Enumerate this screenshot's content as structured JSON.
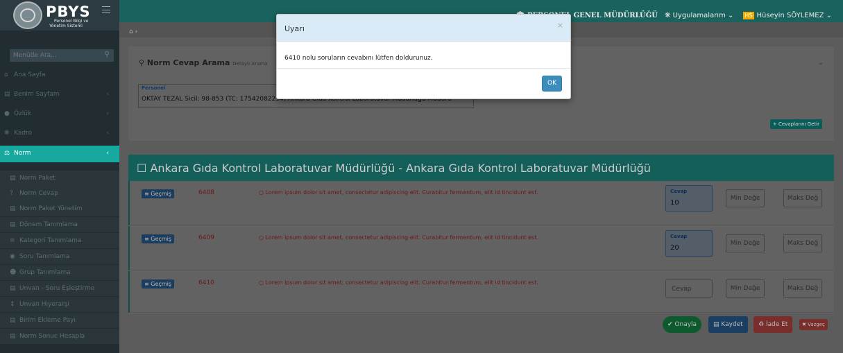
{
  "app": {
    "title": "PBYS",
    "subtitle_line1": "Personel Bilgi ve",
    "subtitle_line2": "Yönetim Sistemi"
  },
  "sidebar": {
    "search_placeholder": "Menüde Ara...",
    "items": [
      {
        "label": "Ana Sayfa",
        "icon": "home-icon"
      },
      {
        "label": "Benim Sayfam",
        "icon": "calendar-icon"
      },
      {
        "label": "Özlük",
        "icon": "user-icon"
      },
      {
        "label": "Kadro",
        "icon": "sitemap-icon"
      },
      {
        "label": "Norm",
        "icon": "balance-icon"
      }
    ],
    "subitems": [
      {
        "label": "Norm Paket",
        "icon": "calendar-icon"
      },
      {
        "label": "Norm Cevap",
        "icon": "question-icon"
      },
      {
        "label": "Norm Paket Yönetim",
        "icon": "calendar-icon"
      },
      {
        "label": "Dönem Tanımlama",
        "icon": "calendar-icon"
      },
      {
        "label": "Kategori Tanımlama",
        "icon": "list-icon"
      },
      {
        "label": "Soru Tanımlama",
        "icon": "question-circle-icon"
      },
      {
        "label": "Grup Tanımlama",
        "icon": "users-icon"
      },
      {
        "label": "Unvan - Soru Eşleştirme",
        "icon": "calendar-icon"
      },
      {
        "label": "Unvan Hiyerarşi",
        "icon": "hierarchy-icon"
      },
      {
        "label": "Birim Ekleme Payı",
        "icon": "calendar-icon"
      },
      {
        "label": "Norm Sonuc Hesapla",
        "icon": "calendar-icon"
      }
    ]
  },
  "topbar": {
    "org": "PERSONEL GENEL MÜDÜRLÜĞÜ",
    "apps": "Uygulamalarım",
    "user_initials": "HS",
    "user_name": "Hüseyin SÖYLEMEZ"
  },
  "search_panel": {
    "title": "Norm Cevap Arama",
    "subtitle": "Detaylı Arama",
    "person_label": "Personel",
    "person_value": "OKTAY TEZAL Sicil: 98-853 (TC: 17542082234) Ankara Gıda Kontrol Laboratuvar Müdürlüğü Müdürü",
    "fetch_button": "Cevaplarını Getir"
  },
  "results": {
    "title": "Ankara Gıda Kontrol Laboratuvar Müdürlüğü - Ankara Gıda Kontrol Laboratuvar Müdürlüğü",
    "history_label": "Geçmiş",
    "answer_label": "Cevap",
    "min_placeholder": "Min Değe",
    "max_placeholder": "Maks Değ",
    "rows": [
      {
        "no": "6408",
        "text": "Lorem ipsum dolor sit amet, consectetur adipiscing elit. Curabitur fermentum, elit id tincidunt est.",
        "answer": "10"
      },
      {
        "no": "6409",
        "text": "Lorem ipsum dolor sit amet, consectetur adipiscing elit. Curabitur fermentum, elit id tincidunt est.",
        "answer": "20"
      },
      {
        "no": "6410",
        "text": "Lorem ipsum dolor sit amet, consectetur adipiscing elit. Curabitur fermentum, elit id tincidunt est.",
        "answer": ""
      }
    ]
  },
  "actions": {
    "approve": "Onayla",
    "save": "Kaydet",
    "return": "İade Et",
    "cancel": "Vazgeç"
  },
  "modal": {
    "title": "Uyarı",
    "message": "6410 nolu soruların cevabını lütfen doldurunuz.",
    "ok": "OK"
  }
}
